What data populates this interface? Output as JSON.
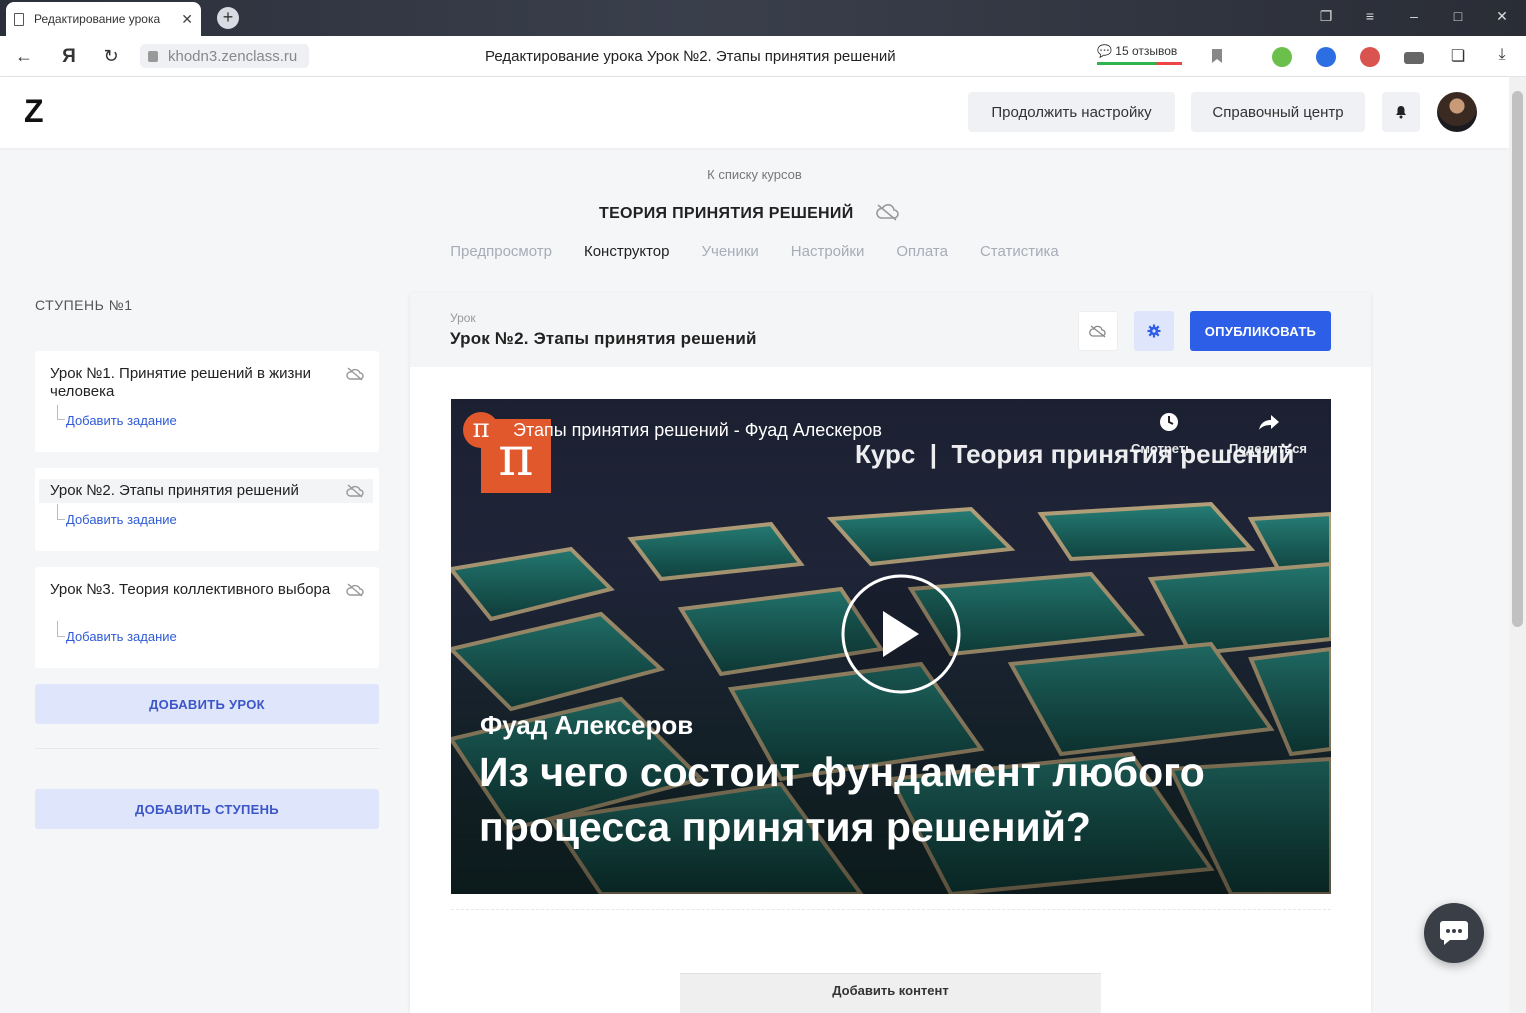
{
  "browser": {
    "tab_title": "Редактирование урока",
    "url": "khodn3.zenclass.ru",
    "page_title": "Редактирование урока Урок №2. Этапы принятия решений",
    "reviews": "15 отзывов"
  },
  "header": {
    "logo": "Z",
    "continue_setup": "Продолжить настройку",
    "help_center": "Справочный центр"
  },
  "course": {
    "back_link": "К списку курсов",
    "title": "ТЕОРИЯ ПРИНЯТИЯ РЕШЕНИЙ",
    "tabs": [
      {
        "label": "Предпросмотр",
        "active": false
      },
      {
        "label": "Конструктор",
        "active": true
      },
      {
        "label": "Ученики",
        "active": false
      },
      {
        "label": "Настройки",
        "active": false
      },
      {
        "label": "Оплата",
        "active": false
      },
      {
        "label": "Статистика",
        "active": false
      }
    ]
  },
  "sidebar": {
    "stage_title": "СТУПЕНЬ №1",
    "lessons": [
      {
        "title": "Урок №1. Принятие решений в жизни человека",
        "add_task": "Добавить задание"
      },
      {
        "title": "Урок №2. Этапы принятия решений",
        "add_task": "Добавить задание"
      },
      {
        "title": "Урок №3. Теория коллективного выбора",
        "add_task": "Добавить задание"
      }
    ],
    "add_lesson": "ДОБАВИТЬ УРОК",
    "add_stage": "ДОБАВИТЬ СТУПЕНЬ"
  },
  "editor": {
    "lesson_label": "Урок",
    "lesson_title": "Урок №2. Этапы принятия решений",
    "publish": "ОПУБЛИКОВАТЬ",
    "add_content": "Добавить контент"
  },
  "video": {
    "channel_logo": "π",
    "title": "Этапы принятия решений - Фуад Алескеров",
    "watch_later": "Смотреть",
    "share": "Поделиться",
    "course_caption": "Курс  |  Теория принятия решений",
    "speaker": "Фуад Алексеров",
    "headline_line1": "Из чего состоит фундамент любого",
    "headline_line2": "процесса принятия решений?"
  },
  "colors": {
    "accent": "#2d5ee8",
    "sidebar_button_bg": "#dfe5fa",
    "link": "#2f5bd6"
  }
}
